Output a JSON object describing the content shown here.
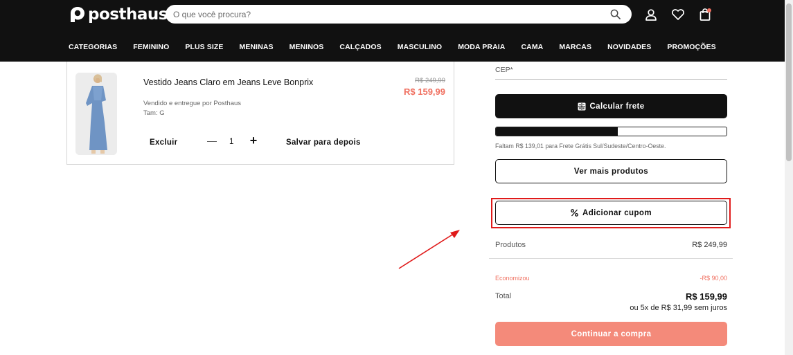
{
  "header": {
    "logo_text": "posthaus",
    "search_placeholder": "O que você procura?",
    "icons": [
      "search-icon",
      "user-icon",
      "heart-icon",
      "bag-icon"
    ],
    "bag_badge_color": "#f07060"
  },
  "nav": {
    "items": [
      "CATEGORIAS",
      "FEMININO",
      "PLUS SIZE",
      "MENINAS",
      "MENINOS",
      "CALÇADOS",
      "MASCULINO",
      "MODA PRAIA",
      "CAMA",
      "MARCAS",
      "NOVIDADES",
      "PROMOÇÕES"
    ]
  },
  "cart": {
    "item": {
      "name": "Vestido Jeans Claro em Jeans Leve Bonprix",
      "seller": "Vendido e entregue por Posthaus",
      "size": "Tam: G",
      "old_price": "R$ 249,99",
      "price": "R$ 159,99",
      "remove_label": "Excluir",
      "quantity": "1",
      "minus_symbol": "—",
      "plus_symbol": "+",
      "save_later_label": "Salvar para depois"
    }
  },
  "summary": {
    "cep_label": "CEP*",
    "calc_frete_label": "Calcular frete",
    "free_shipping_progress": 0.53,
    "free_shipping_message": "Faltam R$ 139,01 para Frete Grátis Sul/Sudeste/Centro-Oeste.",
    "more_products_label": "Ver mais produtos",
    "coupon_label": "Adicionar cupom",
    "products_label": "Produtos",
    "products_value": "R$ 249,99",
    "saved_label": "Economizou",
    "saved_value": "-R$ 90,00",
    "total_label": "Total",
    "total_value": "R$ 159,99",
    "installments": "ou 5x de R$ 31,99 sem juros",
    "continue_label": "Continuar a compra"
  },
  "colors": {
    "header_bg": "#111111",
    "accent_price": "#f07060",
    "continue_button": "#f48a7a",
    "annotation_red": "#e01a1a"
  }
}
